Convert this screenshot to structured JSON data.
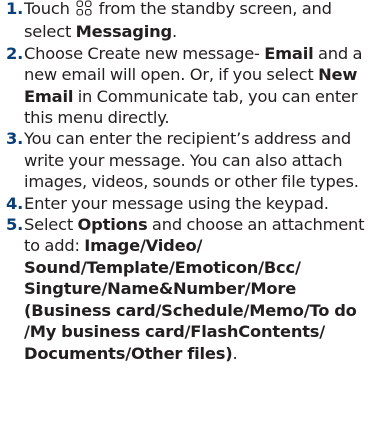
{
  "steps": [
    {
      "number": "1.",
      "text_before_icon": "Touch ",
      "icon": "menu-grid-icon",
      "text_after_icon": " from the standby screen, and select ",
      "bold_1": "Messaging",
      "text_end": "."
    },
    {
      "number": "2.",
      "text_1": "Choose Create new message- ",
      "bold_1": "Email",
      "text_2": " and a new email will open. Or, if you select ",
      "bold_2": "New Email",
      "text_3": " in Communicate tab, you can enter this menu directly."
    },
    {
      "number": "3.",
      "text": "You can enter the recipient’s address and write your message. You can also attach images, videos, sounds or other file types."
    },
    {
      "number": "4.",
      "text": "Enter your message using the keypad."
    },
    {
      "number": "5.",
      "text_1": "Select ",
      "bold_1": "Options",
      "text_2": " and choose an attachment to add: ",
      "bold_2": "Image/Video/ Sound/Template/Emoticon/Bcc/ Singture/Name&Number/More (Business card/Schedule/Memo/To do /My business card/FlashContents/ Documents/Other files)",
      "text_3": "."
    }
  ],
  "colors": {
    "step_number": "#0b3f79",
    "text": "#231f20"
  }
}
